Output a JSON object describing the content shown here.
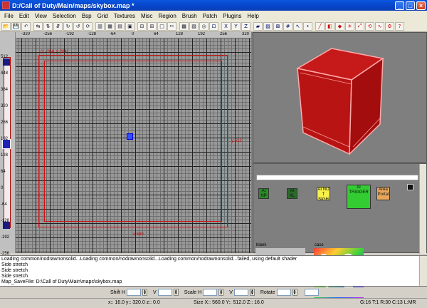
{
  "window": {
    "title": "D:/Call of Duty/Main/maps/skybox.map *"
  },
  "menu": [
    "File",
    "Edit",
    "View",
    "Selection",
    "Bsp",
    "Grid",
    "Textures",
    "Misc",
    "Region",
    "Brush",
    "Patch",
    "Plugins",
    "Help"
  ],
  "toolbar": {
    "icons": [
      "open-icon",
      "save-icon",
      "undo-icon",
      "flip-x-icon",
      "flip-y-icon",
      "flip-z-icon",
      "rotate-x-icon",
      "rotate-y-icon",
      "rotate-z-icon",
      "select-complete-tall-icon",
      "select-touching-icon",
      "select-partial-tall-icon",
      "select-inside-icon",
      "csg-subtract-icon",
      "csg-merge-icon",
      "make-hollow-icon",
      "clipper-icon",
      "cube-icon",
      "patch-icon",
      "camera-icon",
      "lock-icon",
      "x-view-icon",
      "y-view-icon",
      "z-view-icon",
      "brush-icon",
      "texture-icon",
      "texture-lock-icon",
      "grid-icon",
      "select-icon",
      "vertex-icon",
      "edge-icon",
      "face-icon",
      "entity-icon",
      "light-icon",
      "scale-icon",
      "rotate-icon",
      "curve-icon",
      "plug-icon",
      "help-icon"
    ]
  },
  "grid2d": {
    "hruler": [
      "-320",
      "-256",
      "-192",
      "-128",
      "-64",
      "0",
      "64",
      "128",
      "192",
      "256",
      "320"
    ],
    "vruler": [
      "512",
      "448",
      "384",
      "320",
      "256",
      "192",
      "128",
      "64",
      "0",
      "-64",
      "-128",
      "-192",
      "-256"
    ],
    "coord_tag": "(x -264, y 264)",
    "size_y_label": "y:512",
    "size_x_label": "x:560"
  },
  "textures": [
    {
      "name": "ai-np",
      "label": "AI\nNP",
      "color": "#2a8a2a"
    },
    {
      "name": "ai-xl",
      "label": "AI\nXL",
      "color": "#2a6a2a"
    },
    {
      "name": "ai-no-sight",
      "label": "AI NO\nT SIGH",
      "color": "#f7f14a"
    },
    {
      "name": "ai-trigger",
      "label": "AI\nTRIGGER",
      "color": "#33cc33"
    },
    {
      "name": "area-portal",
      "label": "Area\nPortal",
      "color": "#e6a75c"
    }
  ],
  "texture_captions": {
    "blank": "blank",
    "case": "case"
  },
  "case_digits": [
    "1",
    "2",
    "3",
    "4"
  ],
  "console": [
    "Loading common/nodrawnonsolid...Loading common/nodrawnonsolid...Loading common/nodrawnonsolid...failed, using default shader",
    "Side stretch",
    "Side stretch",
    "Side stretch",
    "Map_SaveFile: D:\\Call of Duty\\Main\\maps\\skybox.map"
  ],
  "surface": {
    "shift_h_label": "Shift H",
    "v_label": "V",
    "scale_h_label": "Scale H",
    "v2_label": "V",
    "rotate_label": "Rotate"
  },
  "status": {
    "coords": "x::  16.0   y::  320.0   z::  0.0",
    "size": "Size X:: 560.0  Y:: 512.0  Z:: 16.0",
    "grid": "G:16 T:1 R:30 C:13 L:MR"
  }
}
